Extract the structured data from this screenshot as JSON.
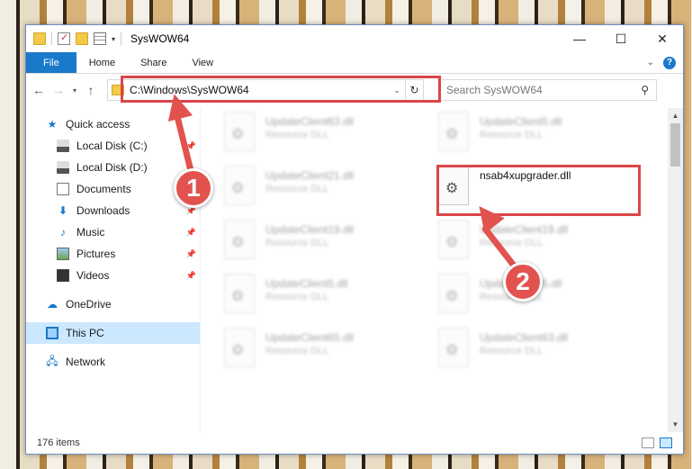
{
  "window": {
    "title": "SysWOW64",
    "controls": {
      "minimize": "—",
      "maximize": "☐",
      "close": "✕"
    }
  },
  "ribbon": {
    "tabs": [
      {
        "label": "File"
      },
      {
        "label": "Home"
      },
      {
        "label": "Share"
      },
      {
        "label": "View"
      }
    ]
  },
  "navigation": {
    "address": "C:\\Windows\\SysWOW64",
    "search_placeholder": "Search SysWOW64"
  },
  "sidebar": {
    "items": [
      {
        "label": "Quick access",
        "icon": "star-icon"
      },
      {
        "label": "Local Disk (C:)",
        "icon": "disk-icon",
        "pinned": true
      },
      {
        "label": "Local Disk (D:)",
        "icon": "disk-icon",
        "pinned": false
      },
      {
        "label": "Documents",
        "icon": "documents-icon",
        "pinned": true
      },
      {
        "label": "Downloads",
        "icon": "download-icon",
        "pinned": true
      },
      {
        "label": "Music",
        "icon": "music-icon",
        "pinned": true
      },
      {
        "label": "Pictures",
        "icon": "pictures-icon",
        "pinned": true
      },
      {
        "label": "Videos",
        "icon": "videos-icon",
        "pinned": true
      },
      {
        "label": "OneDrive",
        "icon": "cloud-icon"
      },
      {
        "label": "This PC",
        "icon": "computer-icon",
        "selected": true
      },
      {
        "label": "Network",
        "icon": "network-icon"
      }
    ]
  },
  "files": [
    {
      "name": "UpdateClient63.dll",
      "type": "Resource DLL",
      "blurred": true
    },
    {
      "name": "UpdateClient5.dll",
      "type": "Resource DLL",
      "blurred": true
    },
    {
      "name": "UpdateClient21.dll",
      "type": "Resource DLL",
      "blurred": true
    },
    {
      "name": "nsab4xupgrader.dll",
      "type": "",
      "blurred": false
    },
    {
      "name": "UpdateClient19.dll",
      "type": "Resource DLL",
      "blurred": true
    },
    {
      "name": "UpdateClient19.dll",
      "type": "Resource DLL",
      "blurred": true
    },
    {
      "name": "UpdateClient5.dll",
      "type": "Resource DLL",
      "blurred": true
    },
    {
      "name": "UpdateClient5.dll",
      "type": "Resource DLL",
      "blurred": true
    },
    {
      "name": "UpdateClient65.dll",
      "type": "Resource DLL",
      "blurred": true
    },
    {
      "name": "UpdateClient63.dll",
      "type": "Resource DLL",
      "blurred": true
    }
  ],
  "status": {
    "item_count": "176 items"
  },
  "annotations": {
    "step1": "1",
    "step2": "2",
    "highlight_color": "#d9464a"
  },
  "colors": {
    "accent": "#1979ca",
    "selection": "#cce8ff"
  }
}
